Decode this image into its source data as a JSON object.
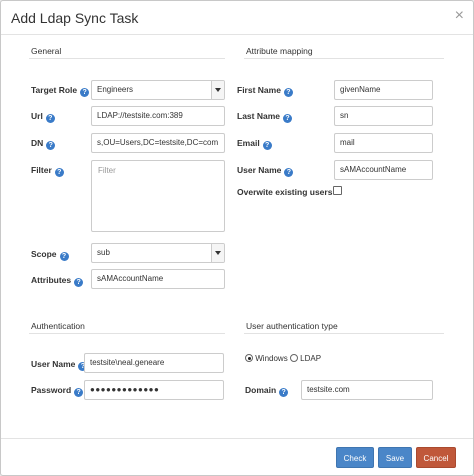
{
  "dialog": {
    "title": "Add Ldap Sync Task",
    "close_glyph": "×"
  },
  "general": {
    "heading": "General",
    "target_role": {
      "label": "Target Role",
      "value": "Engineers"
    },
    "url": {
      "label": "Url",
      "value": "LDAP://testsite.com:389"
    },
    "dn": {
      "label": "DN",
      "value": "s,OU=Users,DC=testsite,DC=com"
    },
    "filter": {
      "label": "Filter",
      "placeholder": "Filter"
    },
    "scope": {
      "label": "Scope",
      "value": "sub"
    },
    "attributes": {
      "label": "Attributes",
      "value": "sAMAccountName"
    }
  },
  "attribute_mapping": {
    "heading": "Attribute mapping",
    "first_name": {
      "label": "First Name",
      "value": "givenName"
    },
    "last_name": {
      "label": "Last Name",
      "value": "sn"
    },
    "email": {
      "label": "Email",
      "value": "mail"
    },
    "user_name": {
      "label": "User Name",
      "value": "sAMAccountName"
    },
    "overwrite": {
      "label": "Overwite existing users",
      "checked": false
    }
  },
  "authentication": {
    "heading": "Authentication",
    "user_name": {
      "label": "User Name",
      "value": "testsite\\neal.geneare"
    },
    "password": {
      "label": "Password",
      "value": "●●●●●●●●●●●●●"
    }
  },
  "user_auth_type": {
    "heading": "User authentication type",
    "options": [
      {
        "label": "Windows",
        "selected": true
      },
      {
        "label": "LDAP",
        "selected": false
      }
    ],
    "domain": {
      "label": "Domain",
      "value": "testsite.com"
    }
  },
  "footer": {
    "check_label": "Check",
    "save_label": "Save",
    "cancel_label": "Cancel"
  },
  "colors": {
    "primary_button": "#4a86c8",
    "cancel_button": "#c0583a",
    "help_icon": "#3a7bc8"
  },
  "icons": {
    "help": "question-circle-icon",
    "dropdown": "chevron-down-icon",
    "close": "close-icon"
  }
}
